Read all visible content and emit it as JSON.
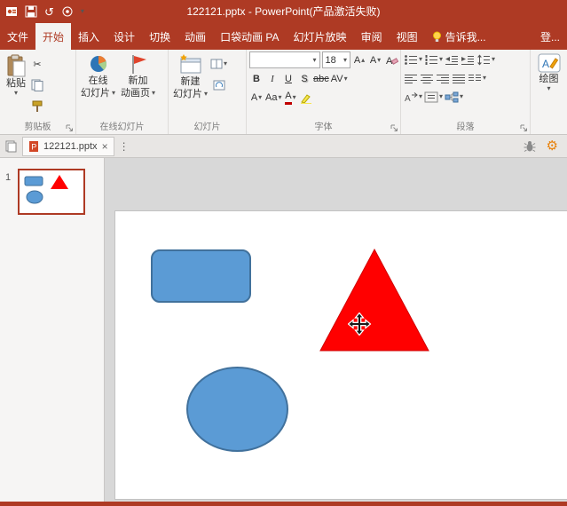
{
  "colors": {
    "brand": "#AE3A24",
    "shape_blue": "#5B9BD5",
    "shape_blue_border": "#41719C",
    "triangle_red": "#FF0000",
    "gear_orange": "#E8820C"
  },
  "icons": {
    "caret": "▾",
    "caret_up": "▴",
    "letter_a": "A",
    "scissors": "✂",
    "undo": "↺",
    "close": "×",
    "kebab": "⋮",
    "gear": "⚙"
  },
  "titlebar": {
    "title": "122121.pptx - PowerPoint(产品激活失败)"
  },
  "tabs": {
    "file": "文件",
    "home": "开始",
    "insert": "插入",
    "design": "设计",
    "transitions": "切换",
    "animations": "动画",
    "pocket": "口袋动画 PA",
    "slideshow": "幻灯片放映",
    "review": "审阅",
    "view": "视图",
    "tellme": "告诉我...",
    "login": "登..."
  },
  "ribbon": {
    "clipboard": {
      "paste": "粘贴",
      "label": "剪贴板"
    },
    "online": {
      "b1_line1": "在线",
      "b1_line2": "幻灯片",
      "b2_line1": "新加",
      "b2_line2": "动画页",
      "label": "在线幻灯片"
    },
    "slides": {
      "new_line1": "新建",
      "new_line2": "幻灯片",
      "label": "幻灯片"
    },
    "font": {
      "name_value": "",
      "size": "18",
      "bold": "B",
      "italic": "I",
      "underline": "U",
      "shadow": "S",
      "strike": "abc",
      "spacing": "AV",
      "color_char": "A",
      "case": "Aa",
      "fontcolor_char": "A",
      "label": "字体"
    },
    "paragraph": {
      "label": "段落"
    },
    "drawing": {
      "button": "绘图"
    }
  },
  "doc_tab": {
    "filename": "122121.pptx"
  },
  "slide_panel": {
    "slide_number": "1"
  }
}
